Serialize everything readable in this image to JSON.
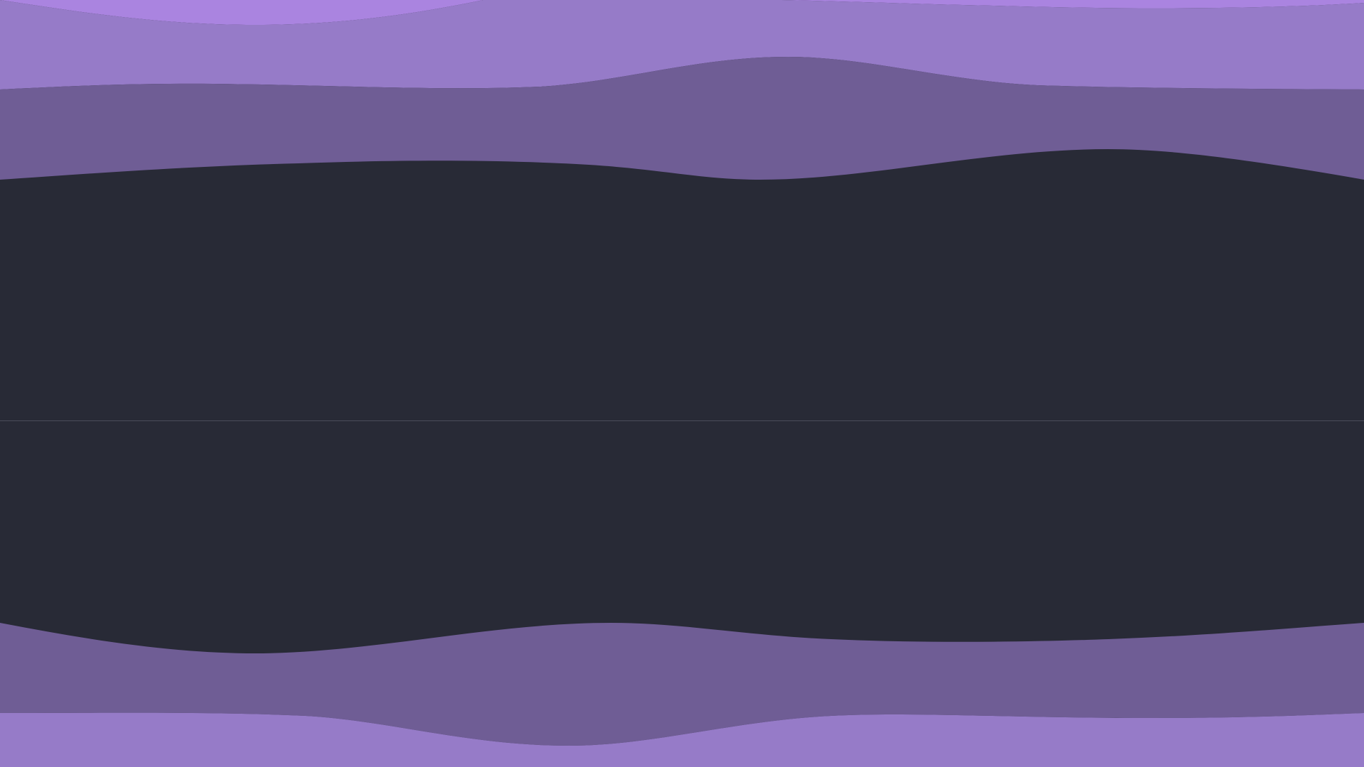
{
  "colors": {
    "background": "#282a36",
    "wave_light": "#aa84e0",
    "wave_mid": "#967bc8",
    "wave_dark": "#6f5d95",
    "divider": "#4a4c5a"
  },
  "layers": [
    {
      "name": "top-wave-lightest",
      "color_key": "wave_light"
    },
    {
      "name": "top-wave-mid",
      "color_key": "wave_mid"
    },
    {
      "name": "top-wave-dark",
      "color_key": "wave_dark"
    },
    {
      "name": "bottom-wave-dark",
      "color_key": "wave_dark"
    },
    {
      "name": "bottom-wave-mid",
      "color_key": "wave_mid"
    }
  ]
}
